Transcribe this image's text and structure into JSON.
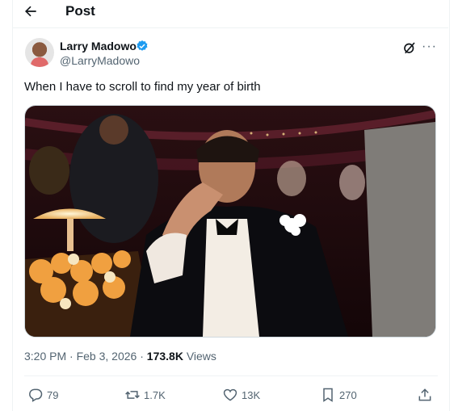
{
  "header": {
    "title": "Post"
  },
  "author": {
    "name": "Larry Madowo",
    "handle": "@LarryMadowo"
  },
  "tweet": {
    "text": "When I have to scroll to find my year of birth"
  },
  "meta": {
    "time": "3:20 PM",
    "separator": "·",
    "date": "Feb 3, 2026",
    "views_count": "173.8K",
    "views_label": "Views"
  },
  "actions": {
    "replies": "79",
    "reposts": "1.7K",
    "likes": "13K",
    "bookmarks": "270"
  },
  "icons": [
    "back-arrow-icon",
    "verified-badge-icon",
    "grok-icon",
    "more-icon",
    "reply-icon",
    "repost-icon",
    "like-icon",
    "bookmark-icon",
    "share-icon"
  ],
  "colors": {
    "verified": "#1d9bf0",
    "secondary_text": "#536471",
    "primary_text": "#0f1419"
  }
}
